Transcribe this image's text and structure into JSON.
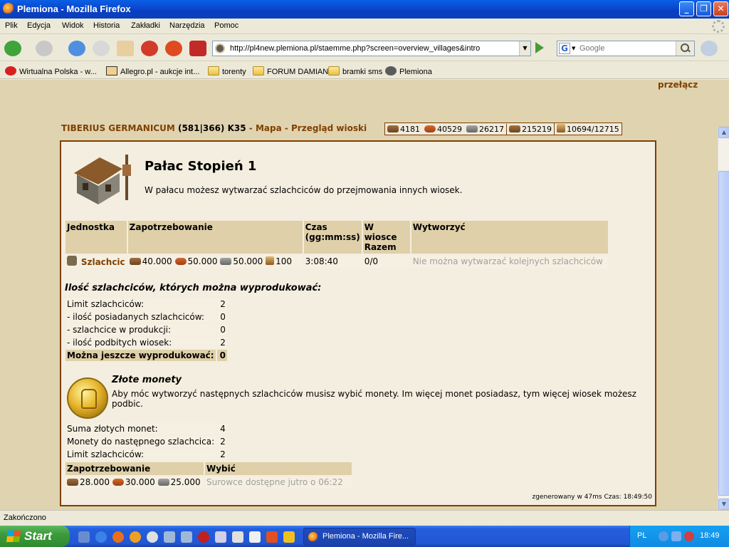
{
  "window": {
    "title": "Plemiona - Mozilla Firefox"
  },
  "menu": [
    "Plik",
    "Edycja",
    "Widok",
    "Historia",
    "Zakładki",
    "Narzędzia",
    "Pomoc"
  ],
  "address": {
    "url": "http://pl4new.plemiona.pl/staemme.php?screen=overview_villages&intro"
  },
  "search": {
    "placeholder": "Google",
    "engine": "G"
  },
  "bookmarks": [
    "Wirtualna Polska - w...",
    "Allegro.pl - aukcje int...",
    "torenty",
    "FORUM DAMIAN",
    "bramki sms",
    "Plemiona"
  ],
  "page": {
    "switch_link": "przełącz",
    "village_name": "TIBERIUS GERMANICUM",
    "village_coords": "(581|366) K35",
    "sep": " - ",
    "map_link": "Mapa",
    "overview_link": "Przegląd wioski",
    "resources": {
      "wood": "4181",
      "clay": "40529",
      "iron": "26217",
      "storage": "215219",
      "population": "10694/12715"
    },
    "building_title": "Pałac Stopień 1",
    "building_desc": "W pałacu możesz wytwarzać szlachciców do przejmowania innych wiosek.",
    "recruit": {
      "headers": [
        "Jednostka",
        "Zapotrzebowanie",
        "Czas (gg:mm:ss)",
        "W wiosce Razem",
        "Wytworzyć"
      ],
      "unit": "Szlachcic",
      "cost_wood": "40.000",
      "cost_clay": "50.000",
      "cost_iron": "50.000",
      "cost_pop": "100",
      "time": "3:08:40",
      "in_village": "0/0",
      "action": "Nie można wytwarzać kolejnych szlachciców"
    },
    "limits_title": "Ilość szlachciców, których można wyprodukować:",
    "limits": [
      {
        "label": "Limit szlachciców:",
        "value": "2"
      },
      {
        "label": "- ilość posiadanych szlachciców:",
        "value": "0"
      },
      {
        "label": "- szlachcice w produkcji:",
        "value": "0"
      },
      {
        "label": "- ilość podbitych wiosek:",
        "value": "2"
      },
      {
        "label": "Można jeszcze wyprodukować:",
        "value": "0"
      }
    ],
    "coins_title": "Złote monety",
    "coins_desc": "Aby móc wytworzyć następnych szlachciców musisz wybić monety. Im więcej monet posiadasz, tym więcej wiosek możesz podbic.",
    "coins": [
      {
        "label": "Suma złotych monet:",
        "value": "4"
      },
      {
        "label": "Monety do następnego szlachcica:",
        "value": "2"
      },
      {
        "label": "Limit szlachciców:",
        "value": "2"
      }
    ],
    "mint": {
      "headers": [
        "Zapotrzebowanie",
        "Wybić"
      ],
      "cost_wood": "28.000",
      "cost_clay": "30.000",
      "cost_iron": "25.000",
      "status": "Surowce dostępne jutro o 06:22"
    },
    "generated": "zgenerowany w 47ms Czas: 18:49:50"
  },
  "statusbar": {
    "text": "Zakończono"
  },
  "taskbar": {
    "start": "Start",
    "task": "Plemiona - Mozilla Fire...",
    "lang": "PL",
    "clock": "18:49"
  }
}
